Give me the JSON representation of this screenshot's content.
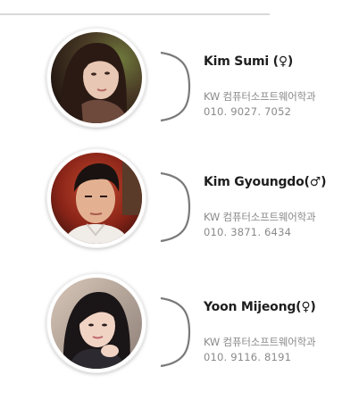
{
  "members": [
    {
      "name": "Kim Sumi (♀)",
      "department": "KW  컴퓨터소프트웨어학과",
      "phone": "010. 9027. 7052",
      "avatar_icon": "female-portrait-icon"
    },
    {
      "name": "Kim Gyoungdo(♂)",
      "department": "KW  컴퓨터소프트웨어학과",
      "phone": "010. 3871. 6434",
      "avatar_icon": "male-portrait-icon"
    },
    {
      "name": "Yoon Mijeong(♀)",
      "department": "KW  컴퓨터소프트웨어학과",
      "phone": "010. 9116. 8191",
      "avatar_icon": "female-portrait-icon"
    }
  ],
  "colors": {
    "name_text": "#1e1e1e",
    "detail_text": "#8a8a8a",
    "bracket": "#7a7a7a",
    "divider": "#d9d9d9"
  }
}
